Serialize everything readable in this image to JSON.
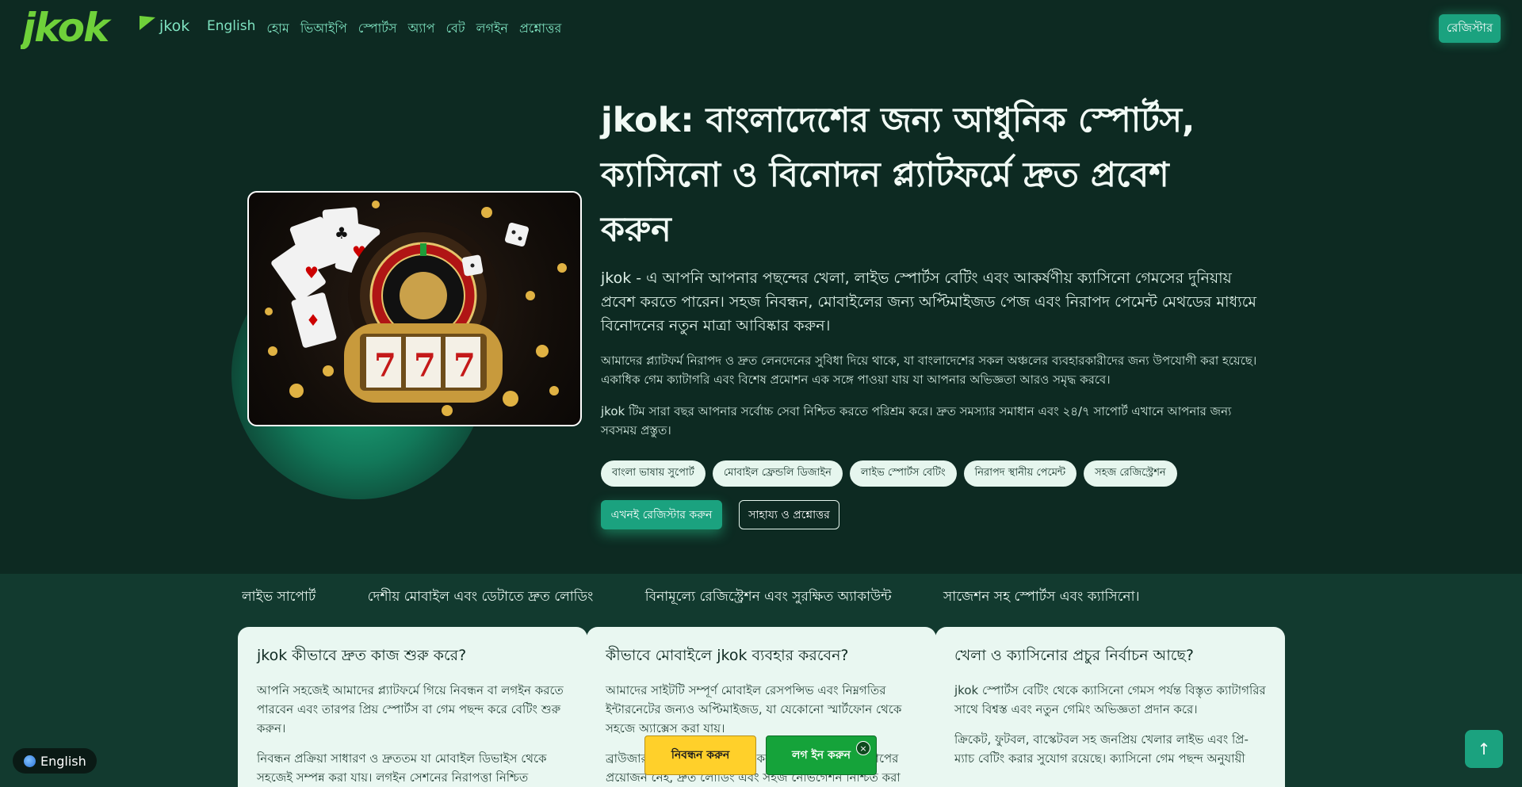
{
  "header": {
    "logo_text": "jkok",
    "brand_name": "jkok",
    "nav": [
      "English",
      "হোম",
      "ভিআইপি",
      "স্পোর্টস",
      "অ্যাপ",
      "বেট",
      "লগইন",
      "প্রশ্নোত্তর"
    ],
    "register_label": "রেজিস্টার"
  },
  "hero": {
    "image_icon": "casino-roulette-slot-image",
    "title": "jkok: বাংলাদেশের জন্য আধুনিক স্পোর্টস, ক্যাসিনো ও বিনোদন প্ল্যাটফর্মে দ্রুত প্রবেশ করুন",
    "lead": "jkok - এ আপনি আপনার পছন্দের খেলা, লাইভ স্পোর্টস বেটিং এবং আকর্ষণীয় ক্যাসিনো গেমসের দুনিয়ায় প্রবেশ করতে পারেন। সহজ নিবন্ধন, মোবাইলের জন্য অপ্টিমাইজড পেজ এবং নিরাপদ পেমেন্ট মেথডের মাধ্যমে বিনোদনের নতুন মাত্রা আবিষ্কার করুন।",
    "p1": "আমাদের প্ল্যাটফর্ম নিরাপদ ও দ্রুত লেনদেনের সুবিধা দিয়ে থাকে, যা বাংলাদেশের সকল অঞ্চলের ব্যবহারকারীদের জন্য উপযোগী করা হয়েছে। একাধিক গেম ক্যাটাগরি এবং বিশেষ প্রমোশন এক সঙ্গে পাওয়া যায় যা আপনার অভিজ্ঞতা আরও সমৃদ্ধ করবে।",
    "p2": "jkok টিম সারা বছর আপনার সর্বোচ্চ সেবা নিশ্চিত করতে পরিশ্রম করে। দ্রুত সমস্যার সমাধান এবং ২৪/৭ সাপোর্ট এখানে আপনার জন্য সবসময় প্রস্তুত।",
    "chips": [
      "বাংলা ভাষায় সুপোর্ট",
      "মোবাইল ফ্রেন্ডলি ডিজাইন",
      "লাইভ স্পোর্টস বেটিং",
      "নিরাপদ স্থানীয় পেমেন্ট",
      "সহজ রেজিস্ট্রেশন"
    ],
    "primary_button": "এখনই রেজিস্টার করুন",
    "secondary_button": "সাহায্য ও প্রশ্নোত্তর"
  },
  "ticker": [
    "লাইভ সাপোর্ট",
    "দেশীয় মোবাইল এবং ডেটাতে দ্রুত লোডিং",
    "বিনামূল্যে রেজিস্ট্রেশন এবং সুরক্ষিত অ্যাকাউন্ট",
    "সাজেশন সহ স্পোর্টস এবং ক্যাসিনো।"
  ],
  "cards": [
    {
      "title": "jkok কীভাবে দ্রুত কাজ শুরু করে?",
      "p1": "আপনি সহজেই আমাদের প্ল্যাটফর্মে গিয়ে নিবন্ধন বা লগইন করতে পারবেন এবং তারপর প্রিয় স্পোর্টস বা গেম পছন্দ করে বেটিং শুরু করুন।",
      "p2": "নিবন্ধন প্রক্রিয়া সাধারণ ও দ্রুততম যা মোবাইল ডিভাইস থেকে সহজেই সম্পন্ন করা যায়। লগইন সেশনের নিরাপত্তা নিশ্চিত"
    },
    {
      "title": "কীভাবে মোবাইলে jkok ব্যবহার করবেন?",
      "p1": "আমাদের সাইটটি সম্পূর্ণ মোবাইল রেসপন্সিভ এবং নিম্নগতির ইন্টারনেটের জন্যও অপ্টিমাইজড, যা যেকোনো স্মার্টফোন থেকে সহজে অ্যাক্সেস করা যায়।",
      "p2": "ব্রাউজার থেকে সরাসরি ব্যবহার করা যায় তাই আলাদা অ্যাপের প্রয়োজন নেই, দ্রুত লোডিং এবং সহজ নেভিগেশন নিশ্চিত করা"
    },
    {
      "title": "খেলা ও ক্যাসিনোর প্রচুর নির্বাচন আছে?",
      "p1": "jkok স্পোর্টস বেটিং থেকে ক্যাসিনো গেমস পর্যন্ত বিস্তৃত ক্যাটাগরির সাথে বিশ্বস্ত এবং নতুন গেমিং অভিজ্ঞতা প্রদান করে।",
      "p2": "ক্রিকেট, ফুটবল, বাস্কেটবল সহ জনপ্রিয় খেলার লাইভ এবং প্রি-ম্যাচ বেটিং করার সুযোগ রয়েছে। ক্যাসিনো গেম পছন্দ অনুযায়ী"
    }
  ],
  "overlay": {
    "language": "English",
    "sticky_register": "নিবন্ধন করুন",
    "sticky_login": "লগ ইন করুন",
    "close_glyph": "×",
    "to_top_glyph": "↑"
  }
}
